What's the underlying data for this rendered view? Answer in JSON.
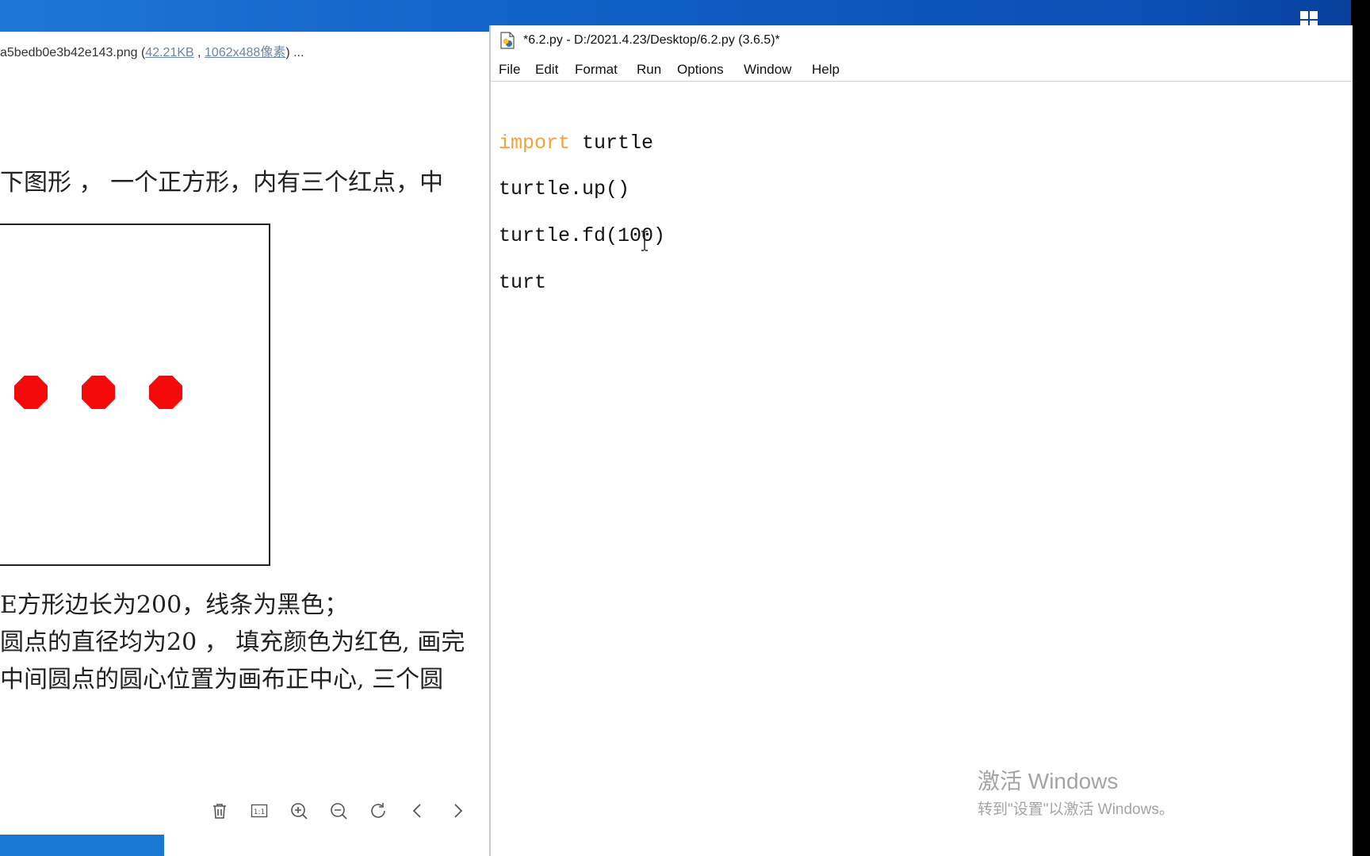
{
  "desktop": {
    "start_icon": "windows-logo-icon"
  },
  "viewer": {
    "filename": "a5bedb0e3b42e143.png (",
    "file_size": "42.21KB",
    "separator": " , ",
    "dimensions": "1062x488像素",
    "suffix": ") ...",
    "description_top": "下图形 ， 一个正方形，内有三个红点，中",
    "description_lines": [
      "E方形边长为200，线条为黑色；",
      "圆点的直径均为20 ， 填充颜色为红色, 画完",
      "中间圆点的圆心位置为画布正中心, 三个圆"
    ],
    "dot_color": "#f40a0a",
    "toolbar_icons": [
      "trash-icon",
      "actual-size-icon",
      "zoom-in-icon",
      "zoom-out-icon",
      "rotate-icon",
      "prev-icon",
      "next-icon"
    ],
    "actual_size_label": "1:1"
  },
  "idle": {
    "title": "*6.2.py - D:/2021.4.23/Desktop/6.2.py (3.6.5)*",
    "menu": [
      "File",
      "Edit",
      "Format",
      "Run",
      "Options",
      "Window",
      "Help"
    ],
    "code": {
      "line1_keyword": "import",
      "line1_rest": " turtle",
      "line2": "turtle.up()",
      "line3": "turtle.fd(100)",
      "line4": "turt"
    },
    "keyword_color": "#f0a43a"
  },
  "watermark": {
    "line1": "激活 Windows",
    "line2": "转到\"设置\"以激活 Windows。"
  }
}
